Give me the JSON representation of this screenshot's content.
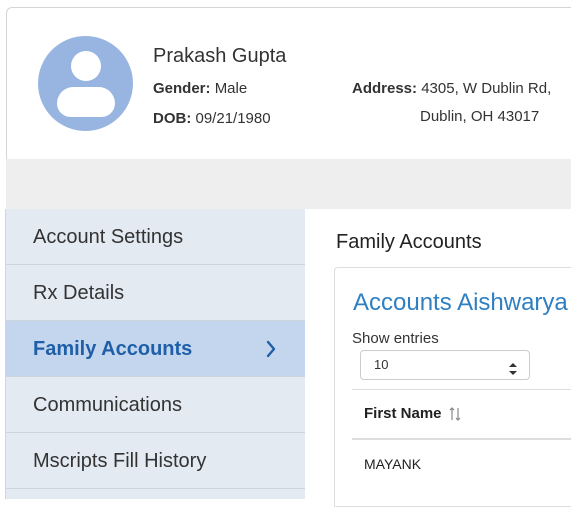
{
  "profile": {
    "name": "Prakash Gupta",
    "gender_label": "Gender:",
    "gender_value": "Male",
    "dob_label": "DOB:",
    "dob_value": "09/21/1980",
    "address_label": "Address:",
    "address_line1": "4305, W Dublin Rd,",
    "address_line2": "Dublin, OH  43017",
    "avatar_icon": "user-avatar-icon",
    "avatar_color": "#98b5e2"
  },
  "sidebar": {
    "items": [
      {
        "label": "Account Settings",
        "active": false
      },
      {
        "label": "Rx Details",
        "active": false
      },
      {
        "label": "Family Accounts",
        "active": true
      },
      {
        "label": "Communications",
        "active": false
      },
      {
        "label": "Mscripts Fill History",
        "active": false
      }
    ],
    "active_color": "#1f5fa8",
    "active_bg": "#c4d6ee",
    "active_icon": "chevron-right-icon"
  },
  "main": {
    "section_title": "Family Accounts",
    "panel_title": "Accounts Aishwarya",
    "show_entries_label": "Show entries",
    "entries_selected": "10",
    "table": {
      "columns": [
        "First Name"
      ],
      "rows": [
        [
          "MAYANK"
        ]
      ]
    },
    "title_color": "#2f7fc3"
  }
}
